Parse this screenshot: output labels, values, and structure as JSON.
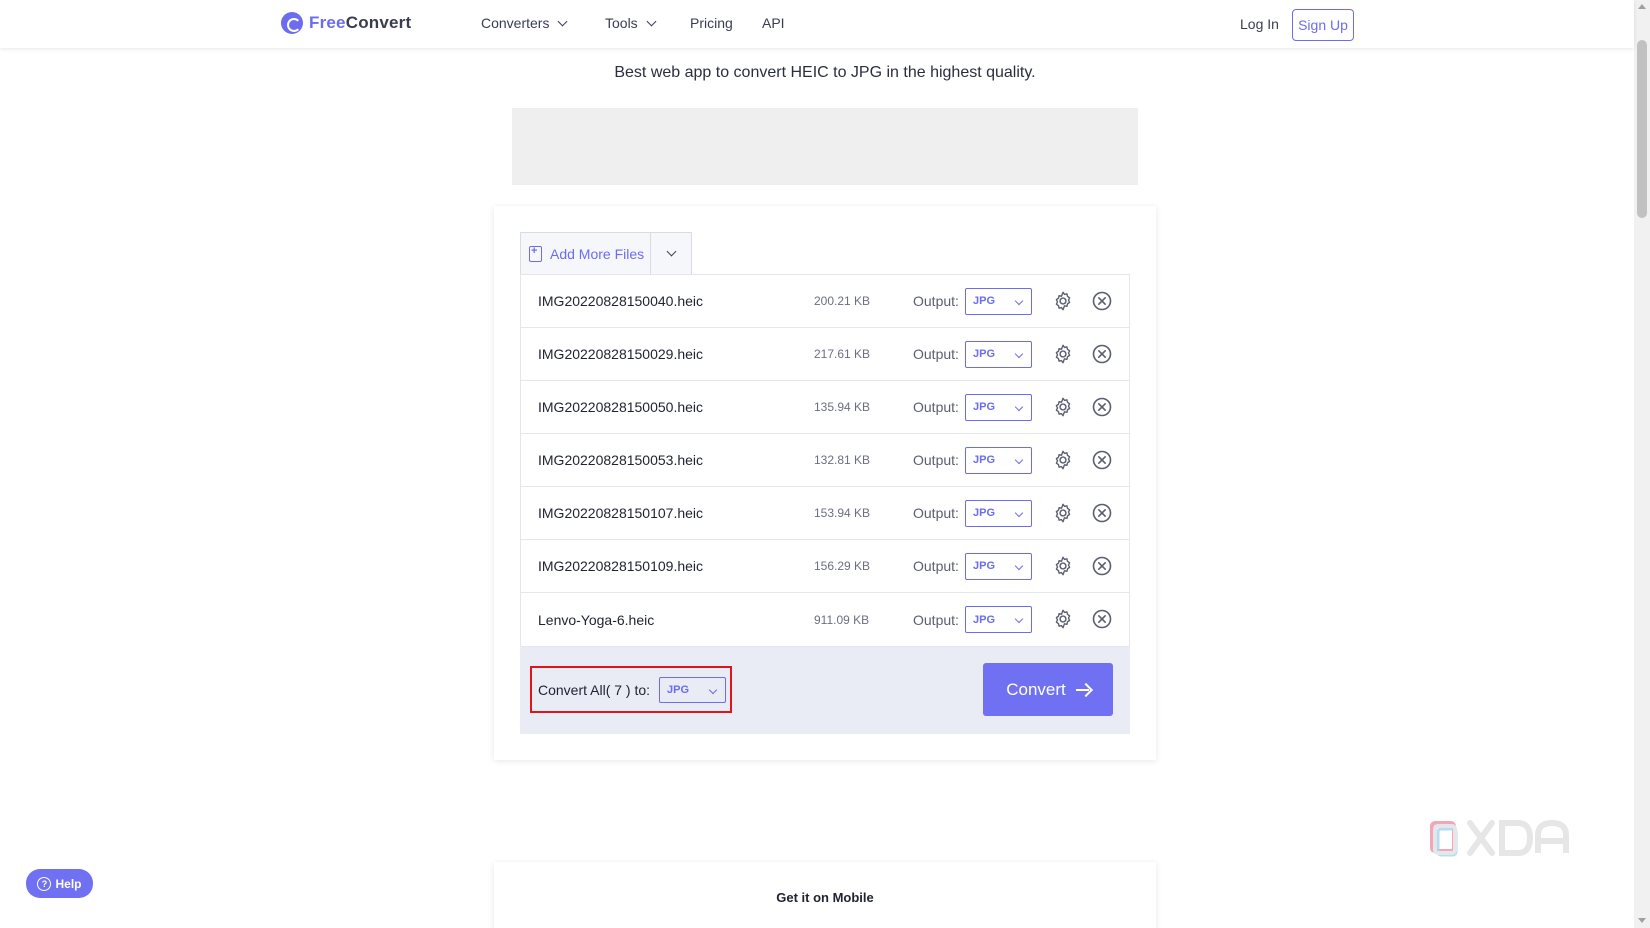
{
  "header": {
    "logo_free": "Free",
    "logo_convert": "Convert",
    "nav": [
      "Converters",
      "Tools",
      "Pricing",
      "API"
    ],
    "login": "Log In",
    "signup": "Sign Up"
  },
  "tagline": "Best web app to convert HEIC to JPG in the highest quality.",
  "uploader": {
    "add_files_label": "Add More Files",
    "output_label": "Output:",
    "files": [
      {
        "name": "IMG20220828150040.heic",
        "size": "200.21 KB",
        "format": "JPG"
      },
      {
        "name": "IMG20220828150029.heic",
        "size": "217.61 KB",
        "format": "JPG"
      },
      {
        "name": "IMG20220828150050.heic",
        "size": "135.94 KB",
        "format": "JPG"
      },
      {
        "name": "IMG20220828150053.heic",
        "size": "132.81 KB",
        "format": "JPG"
      },
      {
        "name": "IMG20220828150107.heic",
        "size": "153.94 KB",
        "format": "JPG"
      },
      {
        "name": "IMG20220828150109.heic",
        "size": "156.29 KB",
        "format": "JPG"
      },
      {
        "name": "Lenvo-Yoga-6.heic",
        "size": "911.09 KB",
        "format": "JPG"
      }
    ],
    "convert_all_label": "Convert All( 7 ) to:",
    "convert_all_format": "JPG",
    "convert_button": "Convert"
  },
  "help_label": "Help",
  "mobile_title": "Get it on Mobile",
  "watermark": "XDA",
  "colors": {
    "accent": "#7070f2",
    "highlight": "#e0151c"
  }
}
